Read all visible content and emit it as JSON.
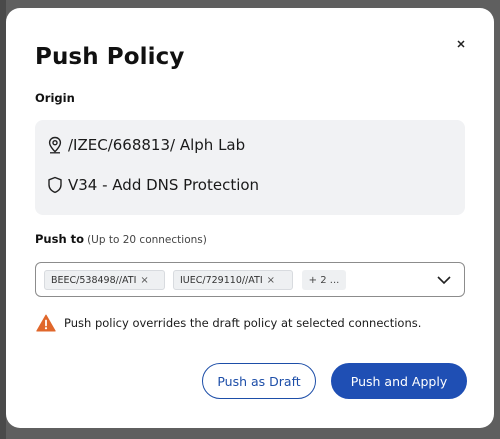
{
  "modal": {
    "title": "Push Policy",
    "close_icon": "close-icon"
  },
  "origin": {
    "label": "Origin",
    "location": "/IZEC/668813/ Alph Lab",
    "location_icon": "location-pin-icon",
    "policy": "V34 - Add DNS Protection",
    "policy_icon": "shield-icon"
  },
  "push_to": {
    "label": "Push to",
    "hint": "(Up to 20 connections)",
    "chips": [
      {
        "label": "BEEC/538498//ATI",
        "remove": "×"
      },
      {
        "label": "IUEC/729110//ATI",
        "remove": "×"
      }
    ],
    "more": "+ 2 ..."
  },
  "warning": {
    "icon": "warning-icon",
    "text": "Push policy overrides the draft policy at selected connections."
  },
  "actions": {
    "draft": "Push as Draft",
    "apply": "Push and Apply"
  },
  "colors": {
    "primary": "#1f4fb4",
    "warning": "#e0672b",
    "origin_bg": "#f1f2f4"
  }
}
